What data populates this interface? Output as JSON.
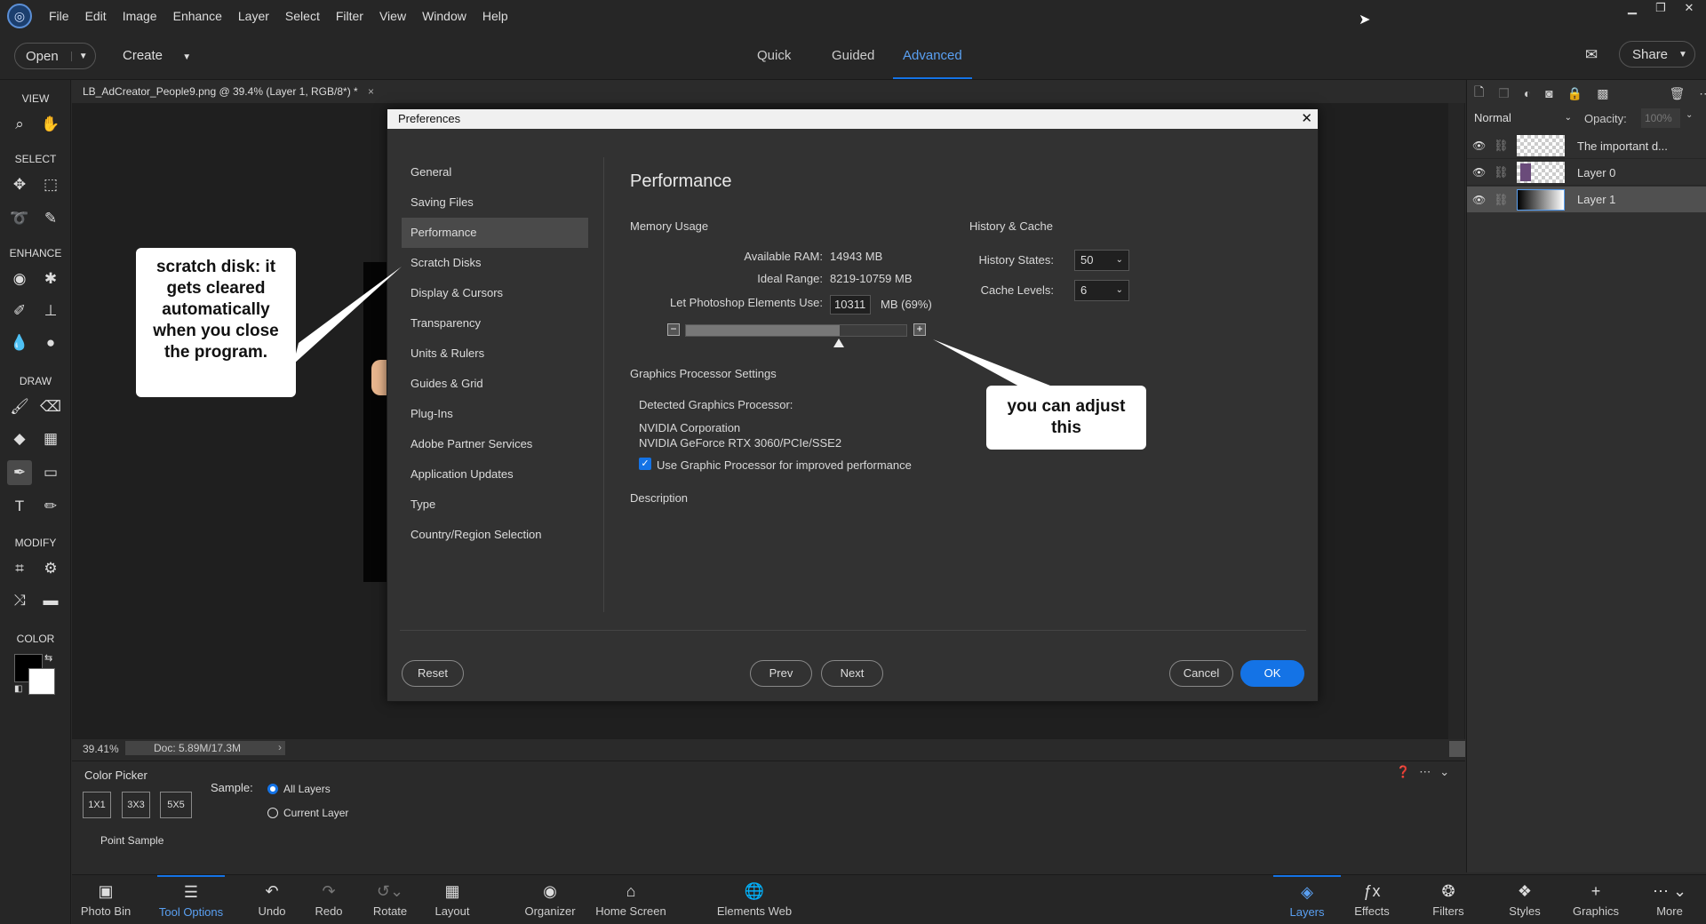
{
  "menubar": {
    "items": [
      "File",
      "Edit",
      "Image",
      "Enhance",
      "Layer",
      "Select",
      "Filter",
      "View",
      "Window",
      "Help"
    ]
  },
  "topbar": {
    "open_label": "Open",
    "create_label": "Create",
    "modes": [
      "Quick",
      "Guided",
      "Advanced"
    ],
    "active_mode": "Advanced",
    "share_label": "Share"
  },
  "document": {
    "tab_title": "LB_AdCreator_People9.png @ 39.4% (Layer 1, RGB/8*) *",
    "zoom": "39.41%",
    "doc_info": "Doc: 5.89M/17.3M"
  },
  "left_tools": {
    "view": "VIEW",
    "select": "SELECT",
    "enhance": "ENHANCE",
    "draw": "DRAW",
    "modify": "MODIFY",
    "color": "COLOR"
  },
  "layers_panel": {
    "blend_mode": "Normal",
    "opacity_label": "Opacity:",
    "opacity_value": "100%",
    "layers": [
      {
        "name": "The important d..."
      },
      {
        "name": "Layer 0"
      },
      {
        "name": "Layer 1"
      }
    ]
  },
  "tool_options": {
    "title": "Color Picker",
    "sizes": [
      "1X1",
      "3X3",
      "5X5"
    ],
    "sample_label": "Sample:",
    "sample_options": [
      "All Layers",
      "Current Layer"
    ],
    "sample_selected": "All Layers",
    "point_sample": "Point Sample"
  },
  "bottombar": {
    "left": [
      "Photo Bin",
      "Tool Options",
      "Undo",
      "Redo",
      "Rotate",
      "Layout",
      "Organizer",
      "Home Screen",
      "Elements Web"
    ],
    "right": [
      "Layers",
      "Effects",
      "Filters",
      "Styles",
      "Graphics",
      "More"
    ]
  },
  "dialog": {
    "title": "Preferences",
    "nav": [
      "General",
      "Saving Files",
      "Performance",
      "Scratch Disks",
      "Display & Cursors",
      "Transparency",
      "Units & Rulers",
      "Guides & Grid",
      "Plug-Ins",
      "Adobe Partner Services",
      "Application Updates",
      "Type",
      "Country/Region Selection"
    ],
    "active_nav": "Performance",
    "heading": "Performance",
    "memory": {
      "title": "Memory Usage",
      "available_label": "Available RAM:",
      "available_value": "14943 MB",
      "ideal_label": "Ideal Range:",
      "ideal_value": "8219-10759 MB",
      "use_label": "Let Photoshop Elements Use:",
      "use_value": "10311",
      "use_unit": "MB (69%)",
      "slider_fraction": 0.69
    },
    "history": {
      "title": "History & Cache",
      "states_label": "History States:",
      "states_value": "50",
      "cache_label": "Cache Levels:",
      "cache_value": "6"
    },
    "gpu": {
      "title": "Graphics Processor Settings",
      "detected_label": "Detected Graphics Processor:",
      "vendor": "NVIDIA Corporation",
      "model": "NVIDIA GeForce RTX 3060/PCIe/SSE2",
      "checkbox_label": "Use Graphic Processor for improved performance",
      "checked": true
    },
    "description_label": "Description",
    "buttons": {
      "reset": "Reset",
      "prev": "Prev",
      "next": "Next",
      "cancel": "Cancel",
      "ok": "OK"
    }
  },
  "callouts": {
    "scratch": "scratch disk: it gets cleared automatically when you close the program.",
    "adjust": "you can adjust this"
  },
  "colors": {
    "accent": "#1473e6",
    "panel": "#323232",
    "menubar": "#262626"
  }
}
